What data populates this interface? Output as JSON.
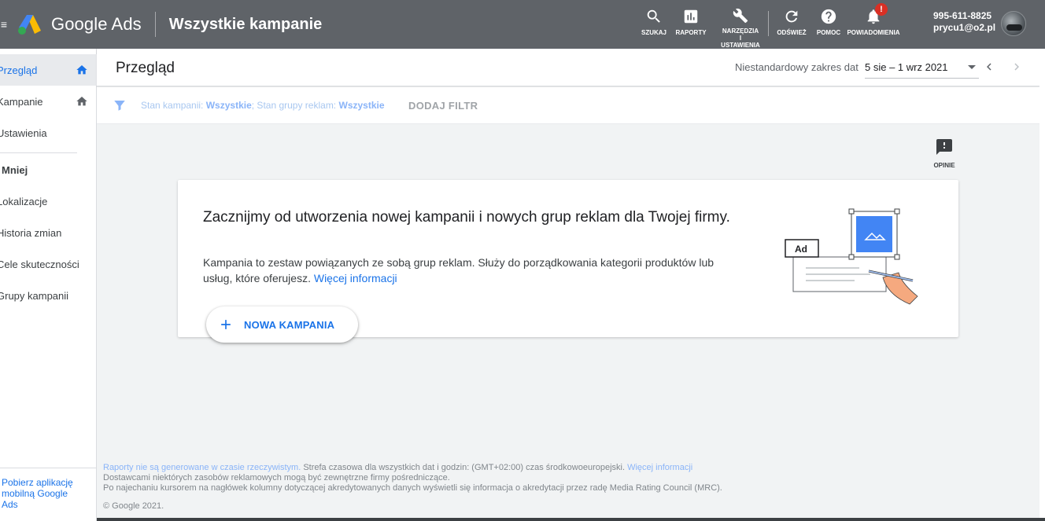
{
  "topbar": {
    "menu_icon": "menu-icon",
    "brand": "Google Ads",
    "section_title": "Wszystkie kampanie",
    "tools": [
      {
        "label": "SZUKAJ",
        "icon": "search-icon"
      },
      {
        "label": "RAPORTY",
        "icon": "bar-chart-icon"
      },
      {
        "label": "NARZĘDZIA I USTAWIENIA",
        "icon": "wrench-icon"
      },
      {
        "label": "ODŚWIEŻ",
        "icon": "refresh-icon"
      },
      {
        "label": "POMOC",
        "icon": "help-icon"
      },
      {
        "label": "POWIADOMIENIA",
        "icon": "bell-icon",
        "badge": "!"
      }
    ],
    "account_id": "995-611-8825",
    "account_email": "prycu1@o2.pl"
  },
  "sidebar": {
    "items": [
      {
        "label": "Przegląd"
      },
      {
        "label": "Kampanie"
      },
      {
        "label": "Ustawienia"
      }
    ],
    "less_label": "Mniej",
    "more_items": [
      {
        "label": "Lokalizacje"
      },
      {
        "label": "Historia zmian"
      },
      {
        "label": "Cele skuteczności"
      },
      {
        "label": "Grupy kampanii"
      }
    ],
    "app_link": "Pobierz aplikację mobilną Google Ads"
  },
  "header": {
    "title": "Przegląd",
    "date_range_label": "Niestandardowy zakres dat",
    "date_range_value": "5 sie – 1 wrz 2021"
  },
  "filter": {
    "status_campaign_label": "Stan kampanii:",
    "status_campaign_value": "Wszystkie",
    "status_adgroup_label": "; Stan grupy reklam:",
    "status_adgroup_value": "Wszystkie",
    "add_filter": "DODAJ FILTR"
  },
  "feedback": {
    "label": "OPINIE"
  },
  "card": {
    "title": "Zacznijmy od utworzenia nowej kampanii i nowych grup reklam dla Twojej firmy.",
    "description": "Kampania to zestaw powiązanych ze sobą grup reklam. Służy do porządkowania kategorii produktów lub usług, które oferujesz.",
    "more_link": "Więcej informacji",
    "illustration_badge": "Ad",
    "new_campaign_button": "NOWA KAMPANIA"
  },
  "footer": {
    "realtime_link": "Raporty nie są generowane w czasie rzeczywistym.",
    "timezone_text": " Strefa czasowa dla wszystkich dat i godzin: (GMT+02:00) czas środkowoeuropejski.",
    "more_link": "Więcej informacji",
    "line2": "Dostawcami niektórych zasobów reklamowych mogą być zewnętrzne firmy pośredniczące.",
    "line3": "Po najechaniu kursorem na nagłówek kolumny dotyczącej akredytowanych danych wyświetli się informacja o akredytacji przez radę Media Rating Council (MRC).",
    "copyright": "© Google 2021."
  },
  "colors": {
    "topbar": "#5f6368",
    "accent": "#1a73e8",
    "badge": "#d93025"
  }
}
